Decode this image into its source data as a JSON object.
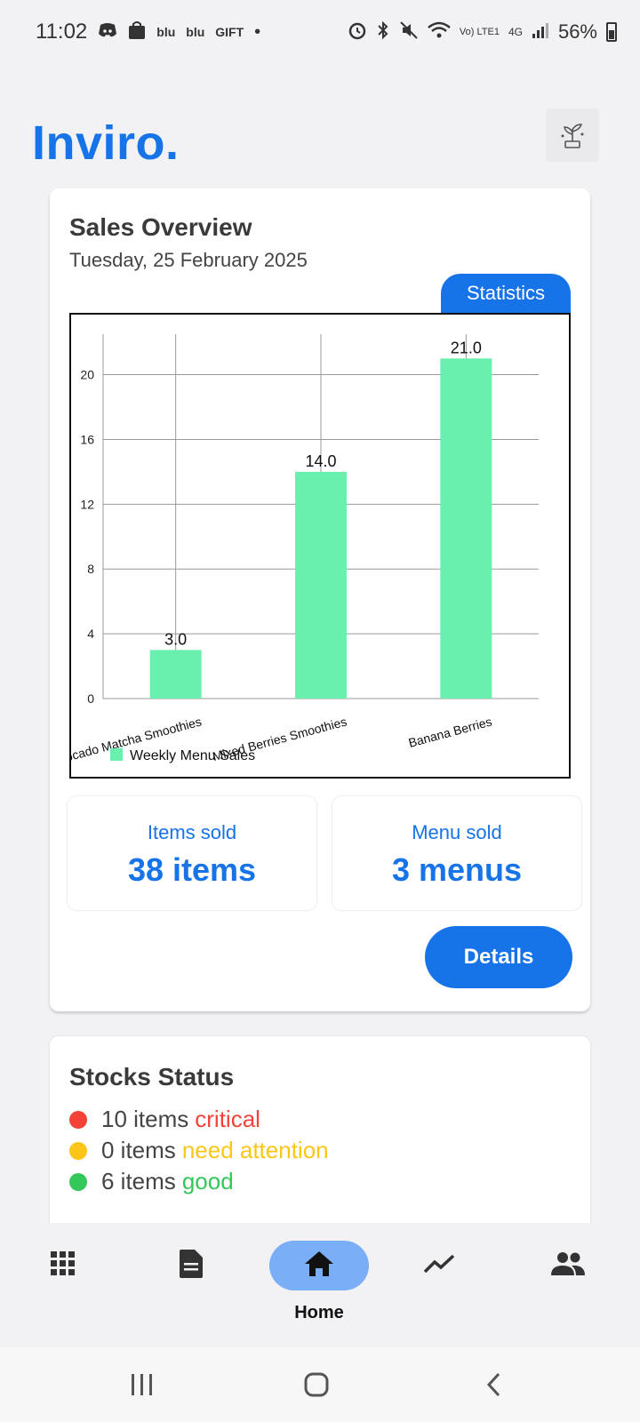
{
  "status_bar": {
    "time": "11:02",
    "left_icons": [
      "discord-icon",
      "shopping-bag-icon",
      "blu-label",
      "blu-label",
      "gift-icon",
      "dot-icon"
    ],
    "blu_text_1": "blu",
    "blu_text_2": "blu",
    "gift_text": "GIFT",
    "right_icons": [
      "alarm-icon",
      "bluetooth-icon",
      "mute-icon",
      "wifi-icon",
      "volte-icon",
      "4g-icon",
      "signal-icon",
      "battery-icon"
    ],
    "volte_text": "Vo) LTE1",
    "network_text": "4G",
    "battery": "56%"
  },
  "header": {
    "logo": "Inviro.",
    "action_icon": "plant-icon"
  },
  "sales_overview": {
    "title": "Sales Overview",
    "date": "Tuesday, 25 February 2025",
    "tab_label": "Statistics",
    "items_sold_label": "Items sold",
    "items_sold_value": "38 items",
    "menu_sold_label": "Menu sold",
    "menu_sold_value": "3 menus",
    "details_button": "Details"
  },
  "chart_data": {
    "type": "bar",
    "categories": [
      "Avocado Matcha Smoothies",
      "Mixed Berries Smoothies",
      "Banana Berries"
    ],
    "series": [
      {
        "name": "Weekly Menu Sales",
        "values": [
          3.0,
          14.0,
          21.0
        ],
        "color": "#69f0ae"
      }
    ],
    "value_labels": [
      "3.0",
      "14.0",
      "21.0"
    ],
    "ylim": [
      0,
      22.5
    ],
    "yticks": [
      "0",
      "4",
      "8",
      "12",
      "16",
      "20"
    ],
    "grid": true,
    "legend_position": "bottom-left",
    "title": "",
    "xlabel": "",
    "ylabel": ""
  },
  "stocks_status": {
    "title": "Stocks Status",
    "rows": [
      {
        "count": "10 items",
        "status": "critical",
        "color": "#f44336"
      },
      {
        "count": "0 items",
        "status": "need attention",
        "color": "#fbc617"
      },
      {
        "count": "6 items",
        "status": "good",
        "color": "#34c759"
      }
    ]
  },
  "bottom_nav": {
    "items": [
      {
        "icon": "grid-icon",
        "label": ""
      },
      {
        "icon": "document-icon",
        "label": ""
      },
      {
        "icon": "home-icon",
        "label": "Home",
        "active": true
      },
      {
        "icon": "trending-icon",
        "label": ""
      },
      {
        "icon": "people-icon",
        "label": ""
      }
    ]
  },
  "system_nav": {
    "items": [
      "recents-icon",
      "home-circle-icon",
      "back-icon"
    ]
  }
}
